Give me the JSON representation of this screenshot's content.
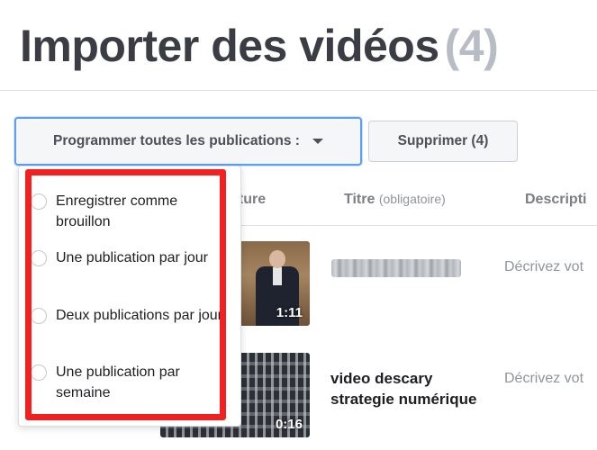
{
  "page": {
    "title": "Importer des vidéos",
    "count": "(4)"
  },
  "toolbar": {
    "schedule_label": "Programmer toutes les publications :",
    "delete_label": "Supprimer (4)"
  },
  "table": {
    "columns": {
      "thumbnail_partial": "ature",
      "title": "Titre",
      "title_note": "(obligatoire)",
      "description_partial": "Descripti"
    },
    "rows": [
      {
        "duration": "1:11",
        "title": "",
        "description_placeholder": "Décrivez vot"
      },
      {
        "duration": "0:16",
        "title": "video descary strategie numérique",
        "description_placeholder": "Décrivez vot"
      }
    ]
  },
  "dropdown": {
    "options": [
      {
        "label": "Enregistrer comme brouillon"
      },
      {
        "label": "Une publication par jour"
      },
      {
        "label": "Deux publications par jour"
      },
      {
        "label": "Une publication par semaine"
      }
    ]
  },
  "colors": {
    "highlight": "#f41f1f",
    "focus_border": "#5aa0f2"
  },
  "icons": [
    "caret-down-icon",
    "radio-icon"
  ]
}
